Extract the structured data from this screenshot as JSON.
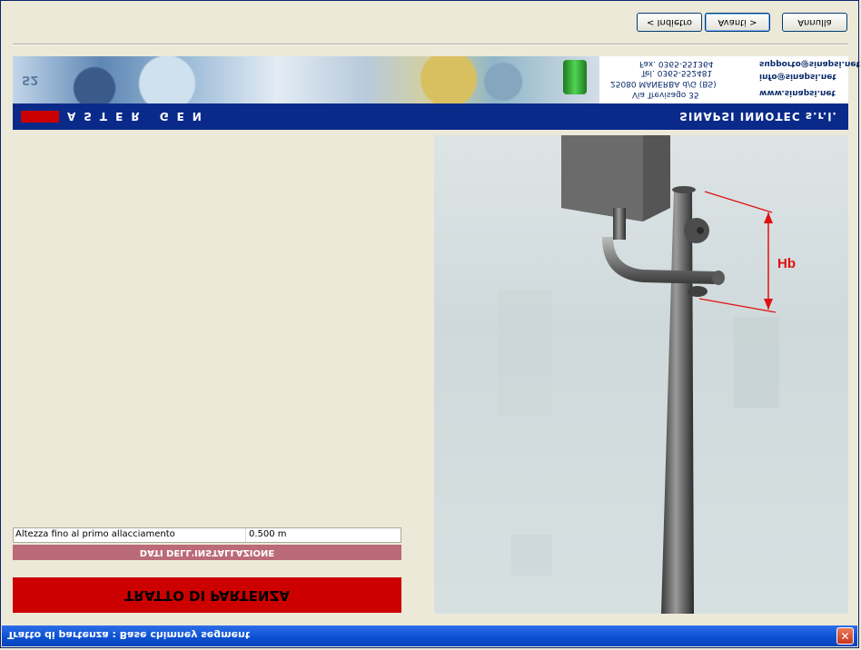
{
  "toolbar": {
    "back_label": "< Indietro",
    "next_label": "Avanti >",
    "cancel_label": "Annulla"
  },
  "banner": {
    "product": "ASTER GEN",
    "company": "SINAPSI INNOTEC s.r.l.",
    "address": "Via Trevisago 35",
    "city": "25080 MANERBA d/G (BS)",
    "tel": "Tel. 0365-552481",
    "fax": "Fax. 0365-551364",
    "website": "www.sinapsi.net",
    "email_info": "info@sinapsi.net",
    "email_support": "supporto@sinapsi.net",
    "logo_mark": "S2"
  },
  "diagram": {
    "dimension_label": "Hb"
  },
  "form": {
    "field_label": "Altezza fino al primo allacciamento",
    "field_value": "0.500 m",
    "section_title": "DATI DELL'INSTALLAZIONE",
    "segment_title": "TRATTO DI PARTENZA"
  },
  "status": {
    "text": "Tratto di partenza : Base chimney segment"
  },
  "colors": {
    "background": "#ece9d8",
    "banner_bar": "#0a2a8a",
    "accent_red": "#cc0000",
    "section_bar": "#bb6a78",
    "dimension_red": "#e01010",
    "statusbar_blue": "#0a4fd2"
  }
}
